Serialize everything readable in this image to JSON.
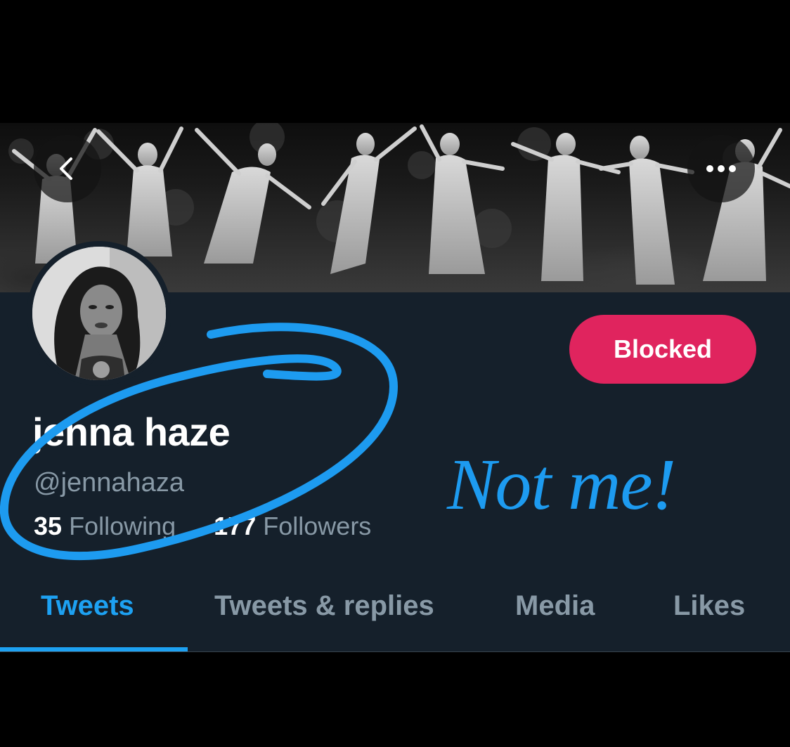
{
  "header": {
    "back_icon": "chevron-left-icon",
    "more_icon": "more-horizontal-icon"
  },
  "profile": {
    "display_name": "jenna haze",
    "handle": "@jennahaza",
    "following_count": "35",
    "following_label": "Following",
    "followers_count": "177",
    "followers_label": "Followers",
    "blocked_label": "Blocked"
  },
  "annotation": {
    "note": "Not me!"
  },
  "tabs": [
    {
      "label": "Tweets",
      "active": true
    },
    {
      "label": "Tweets & replies",
      "active": false
    },
    {
      "label": "Media",
      "active": false
    },
    {
      "label": "Likes",
      "active": false
    }
  ],
  "colors": {
    "background": "#15202b",
    "accent": "#1da1f2",
    "blocked": "#e0245e",
    "secondary_text": "#8899a6"
  }
}
